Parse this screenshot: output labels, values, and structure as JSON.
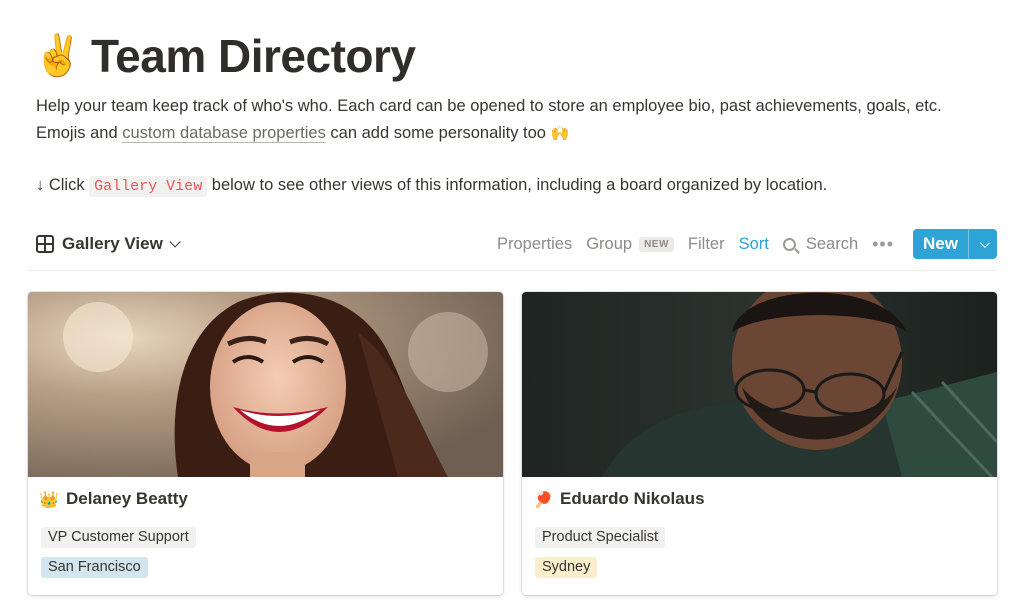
{
  "header": {
    "title_emoji": "✌️",
    "title": "Team Directory"
  },
  "description": {
    "line1": "Help your team keep track of who's who. Each card can be opened to store an employee bio, past achievements, goals, etc.",
    "line2_before": "Emojis and ",
    "line2_link": "custom database properties",
    "line2_after": " can add some personality too ",
    "line2_emoji": "🙌",
    "hint_arrow": "↓ Click ",
    "hint_code": "Gallery View",
    "hint_after": " below to see other views of this information, including a board organized by location."
  },
  "toolbar": {
    "view_label": "Gallery View",
    "view_icon": "gallery-grid-icon",
    "properties": "Properties",
    "group": "Group",
    "group_badge": "NEW",
    "filter": "Filter",
    "sort": "Sort",
    "search": "Search",
    "more": "•••",
    "new_label": "New"
  },
  "colors": {
    "accent": "#2ea3d6",
    "code_red": "#eb5757",
    "tag_gray": "#f1f1ef",
    "tag_blue": "#d3e5ef",
    "tag_yellow": "#fbeecc"
  },
  "cards": [
    {
      "emoji": "👑",
      "name": "Delaney Beatty",
      "role": "VP Customer Support",
      "location": "San Francisco",
      "location_color": "blue",
      "cover": "smiling-woman-photo"
    },
    {
      "emoji": "🏓",
      "name": "Eduardo Nikolaus",
      "role": "Product Specialist",
      "location": "Sydney",
      "location_color": "yellow",
      "cover": "man-with-glasses-photo"
    }
  ]
}
